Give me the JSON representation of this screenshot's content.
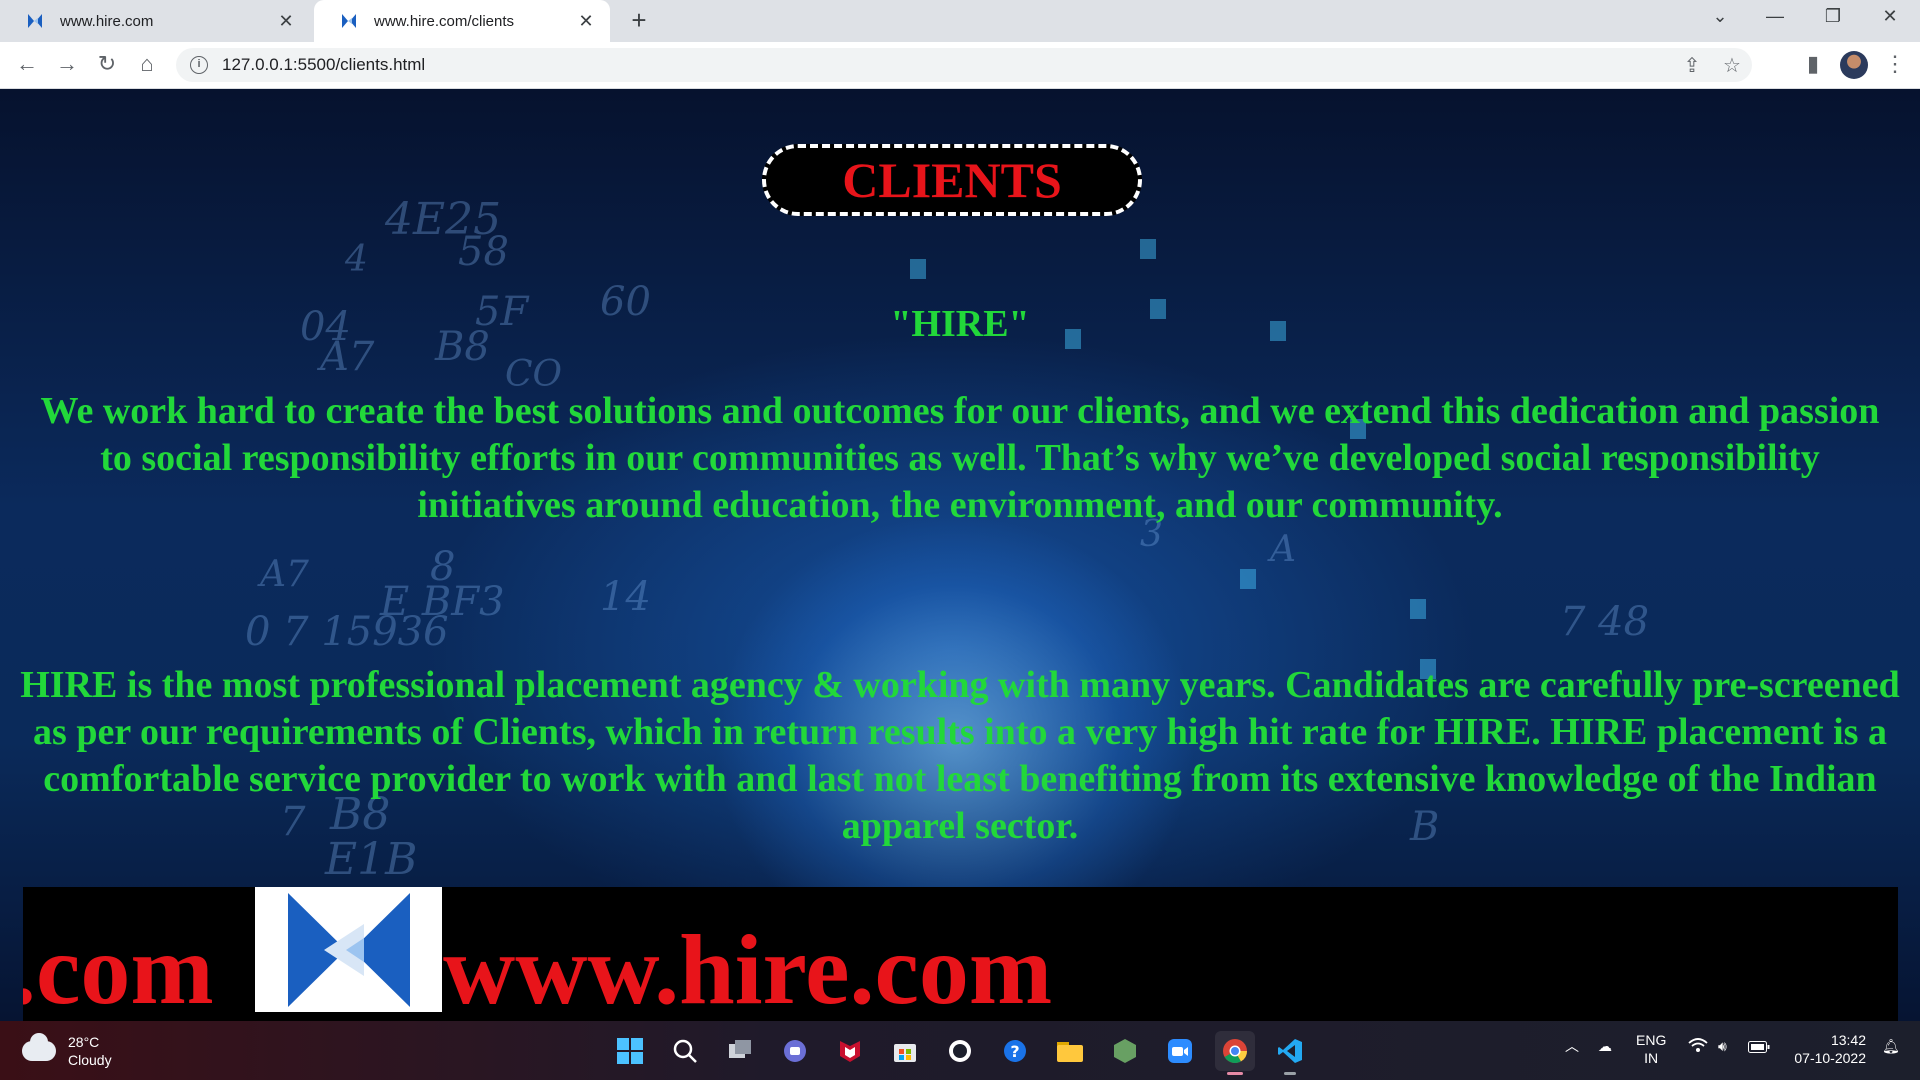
{
  "browser": {
    "tabs": [
      {
        "title": "www.hire.com",
        "active": false
      },
      {
        "title": "www.hire.com/clients",
        "active": true
      }
    ],
    "address": "127.0.0.1:5500/clients.html"
  },
  "page": {
    "heading": "CLIENTS",
    "subheading": "\"HIRE\"",
    "paragraph1": "We work hard to create the best solutions and outcomes for our clients, and we extend this dedication and passion to social responsibility efforts in our communities as well. That’s why we’ve developed social responsibility initiatives around education, the environment, and our community.",
    "paragraph2": "HIRE is the most professional placement agency & working with many years. Candidates are carefully pre-screened as per our requirements of Clients, which in return results into a very high hit rate for HIRE. HIRE placement is a comfortable service provider to work with and last not least benefiting from its extensive knowledge of the Indian apparel sector.",
    "footer_left_text": ".com",
    "footer_site_text": "www.hire.com"
  },
  "taskbar": {
    "weather_temp": "28°C",
    "weather_desc": "Cloudy",
    "language": "ENG",
    "region": "IN",
    "time": "13:42",
    "date": "07-10-2022"
  },
  "colors": {
    "heading_red": "#e8141a",
    "text_green": "#22d83a",
    "logo_blue": "#1a5fc0"
  }
}
